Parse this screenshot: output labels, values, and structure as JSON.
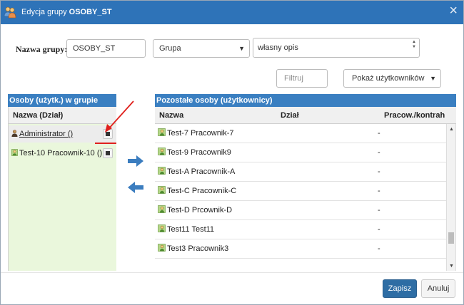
{
  "dialog": {
    "title_prefix": "Edycja grupy",
    "title_group": "OSOBY_ST",
    "close": "×"
  },
  "form": {
    "name_label": "Nazwa grupy:",
    "name_value": "OSOBY_ST",
    "type_value": "Grupa",
    "description_value": "własny opis",
    "filter_placeholder": "Filtruj",
    "show_value": "Pokaż użytkowników"
  },
  "left_panel": {
    "title": "Osoby (użytk.) w grupie",
    "column": "Nazwa (Dział)",
    "items": [
      {
        "label": "Administrator ()",
        "icon": "admin-user-icon"
      },
      {
        "label": "Test-10 Pracownik-10 ()",
        "icon": "user-icon"
      }
    ]
  },
  "right_panel": {
    "title": "Pozostałe osoby (użytkownicy)",
    "columns": [
      "Nazwa",
      "Dział",
      "Pracow./kontrah"
    ],
    "rows": [
      {
        "name": "Test-7 Pracownik-7",
        "dept": "-"
      },
      {
        "name": "Test-9 Pracownik9",
        "dept": "-"
      },
      {
        "name": "Test-A Pracownik-A",
        "dept": "-"
      },
      {
        "name": "Test-C Pracownik-C",
        "dept": "-"
      },
      {
        "name": "Test-D Prcownik-D",
        "dept": "-"
      },
      {
        "name": "Test11 Test11",
        "dept": "-"
      },
      {
        "name": "Test3 Pracownik3",
        "dept": "-"
      }
    ]
  },
  "buttons": {
    "save": "Zapisz",
    "cancel": "Anuluj"
  },
  "colors": {
    "titlebar": "#2e73b8",
    "panel_header": "#3a7fc1",
    "left_bg": "#eaf7dc",
    "arrows": "#3b7dbf",
    "annotation": "#e0201c"
  }
}
